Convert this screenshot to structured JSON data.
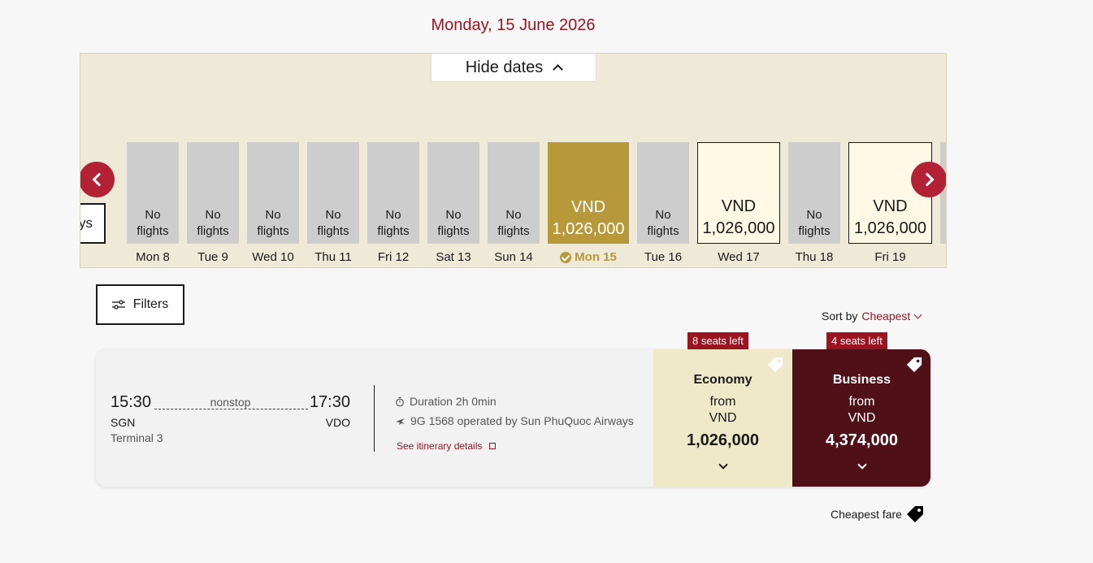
{
  "header": {
    "date": "Monday, 15 June 2026",
    "hide_dates_label": "Hide dates"
  },
  "date_strip": {
    "prev_partial_label": "ys",
    "days": [
      {
        "card_line1": "No",
        "card_line2": "flights",
        "label": "Mon 8",
        "state": "none"
      },
      {
        "card_line1": "No",
        "card_line2": "flights",
        "label": "Tue 9",
        "state": "none"
      },
      {
        "card_line1": "No",
        "card_line2": "flights",
        "label": "Wed 10",
        "state": "none"
      },
      {
        "card_line1": "No",
        "card_line2": "flights",
        "label": "Thu 11",
        "state": "none"
      },
      {
        "card_line1": "No",
        "card_line2": "flights",
        "label": "Fri 12",
        "state": "none"
      },
      {
        "card_line1": "No",
        "card_line2": "flights",
        "label": "Sat 13",
        "state": "none"
      },
      {
        "card_line1": "No",
        "card_line2": "flights",
        "label": "Sun 14",
        "state": "none"
      },
      {
        "card_line1": "VND",
        "card_line2": "1,026,000",
        "label": "Mon 15",
        "state": "selected"
      },
      {
        "card_line1": "No",
        "card_line2": "flights",
        "label": "Tue 16",
        "state": "none"
      },
      {
        "card_line1": "VND",
        "card_line2": "1,026,000",
        "label": "Wed 17",
        "state": "available"
      },
      {
        "card_line1": "No",
        "card_line2": "flights",
        "label": "Thu 18",
        "state": "none"
      },
      {
        "card_line1": "VND",
        "card_line2": "1,026,000",
        "label": "Fri 19",
        "state": "available"
      }
    ]
  },
  "filters": {
    "label": "Filters"
  },
  "sort": {
    "prefix": "Sort by",
    "value": "Cheapest"
  },
  "flight": {
    "departure_time": "15:30",
    "arrival_time": "17:30",
    "stops": "nonstop",
    "origin": "SGN",
    "destination": "VDO",
    "terminal": "Terminal 3",
    "duration": "Duration 2h 0min",
    "operator": "9G 1568 operated by Sun PhuQuoc Airways",
    "itinerary_link": "See itinerary details"
  },
  "fares": {
    "economy": {
      "seats": "8 seats left",
      "class": "Economy",
      "from": "from",
      "currency": "VND",
      "price": "1,026,000"
    },
    "business": {
      "seats": "4 seats left",
      "class": "Business",
      "from": "from",
      "currency": "VND",
      "price": "4,374,000"
    }
  },
  "legend": {
    "label": "Cheapest fare"
  },
  "colors": {
    "brand_red": "#9b1421",
    "selected_gold": "#b7993a",
    "business_bg": "#4f1117",
    "economy_bg": "#efe8c9"
  }
}
